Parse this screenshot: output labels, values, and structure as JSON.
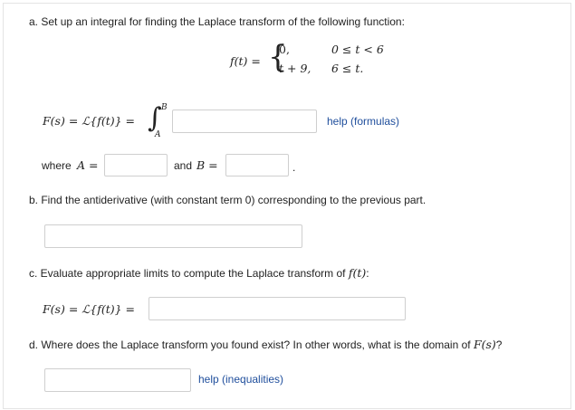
{
  "part_a": {
    "prompt": "a. Set up an integral for finding the Laplace transform of the following function:",
    "f_lhs": "f(t) =",
    "case1_expr": "0,",
    "case1_cond": "0 ≤ t < 6",
    "case2_expr": "t + 9,",
    "case2_cond": "6 ≤ t.",
    "F_lhs": "F(s) = ℒ{f(t)} =",
    "upper_limit": "B",
    "lower_limit": "A",
    "integrand_value": "",
    "help_formulas": "help (formulas)",
    "where_label": "where",
    "A_eq": "A =",
    "A_value": "",
    "and_label": "and",
    "B_eq": "B =",
    "B_value": "",
    "period": "."
  },
  "part_b": {
    "prompt": "b. Find the antiderivative (with constant term 0) corresponding to the previous part.",
    "value": ""
  },
  "part_c": {
    "prompt_prefix": "c. Evaluate appropriate limits to compute the Laplace transform of",
    "prompt_math": "f(t)",
    "prompt_suffix": ":",
    "F_lhs": "F(s) = ℒ{f(t)} =",
    "value": ""
  },
  "part_d": {
    "prompt_prefix": "d. Where does the Laplace transform you found exist? In other words, what is the domain of",
    "prompt_math": "F(s)",
    "prompt_suffix": "?",
    "value": "",
    "help_inequalities": "help (inequalities)"
  }
}
